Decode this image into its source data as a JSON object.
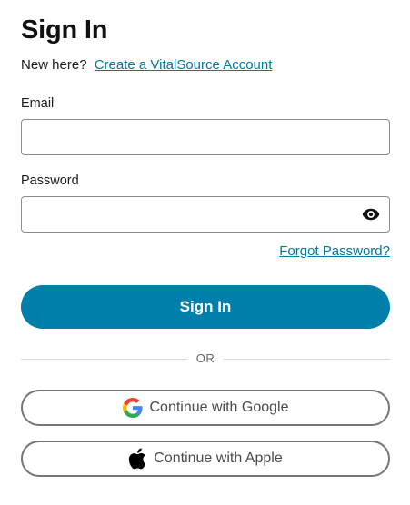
{
  "title": "Sign In",
  "new_here": {
    "text": "New here?",
    "link": "Create a VitalSource Account"
  },
  "email": {
    "label": "Email",
    "value": "",
    "placeholder": ""
  },
  "password": {
    "label": "Password",
    "value": "",
    "placeholder": "",
    "toggle_icon": "eye-icon"
  },
  "forgot_password": "Forgot Password?",
  "sign_in_button": "Sign In",
  "divider_text": "OR",
  "social": {
    "google_label": "Continue with Google",
    "google_icon": "google-icon",
    "apple_label": "Continue with Apple",
    "apple_icon": "apple-icon"
  },
  "colors": {
    "primary": "#007fab",
    "link": "#007a9e",
    "border": "#8c8c8c"
  }
}
